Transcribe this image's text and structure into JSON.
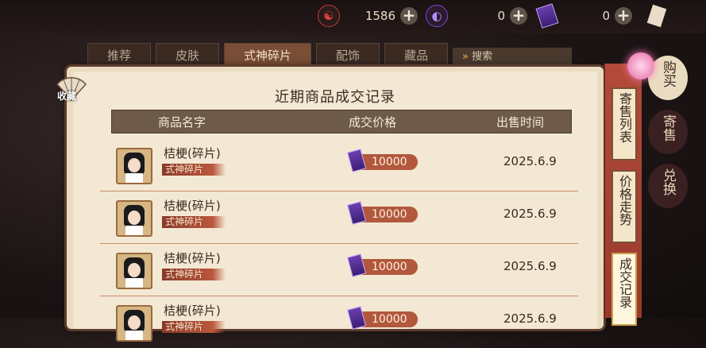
{
  "currencies": [
    {
      "icon": "yin-yang-jade-icon",
      "value": "1586"
    },
    {
      "icon": "purple-orb-icon",
      "value": "0"
    },
    {
      "icon": "purple-ticket-icon",
      "value": "0"
    }
  ],
  "tabs": [
    "推荐",
    "皮肤",
    "式神碎片",
    "配饰",
    "藏品"
  ],
  "search_placeholder": "搜索",
  "favorite_label": "收藏",
  "panel": {
    "title": "近期商品成交记录",
    "columns": {
      "name": "商品名字",
      "price": "成交价格",
      "time": "出售时间"
    },
    "rows": [
      {
        "name": "桔梗(碎片)",
        "tag": "式神碎片",
        "price": "10000",
        "date": "2025.6.9"
      },
      {
        "name": "桔梗(碎片)",
        "tag": "式神碎片",
        "price": "10000",
        "date": "2025.6.9"
      },
      {
        "name": "桔梗(碎片)",
        "tag": "式神碎片",
        "price": "10000",
        "date": "2025.6.9"
      },
      {
        "name": "桔梗(碎片)",
        "tag": "式神碎片",
        "price": "10000",
        "date": "2025.6.9"
      }
    ]
  },
  "side_tabs": [
    "寄售列表",
    "价格走势",
    "成交记录"
  ],
  "categories": [
    "购买",
    "寄售",
    "兑换"
  ],
  "colors": {
    "accent": "#b2583c",
    "panel": "#f3e8d3",
    "nav_red": "#b34a3a"
  }
}
